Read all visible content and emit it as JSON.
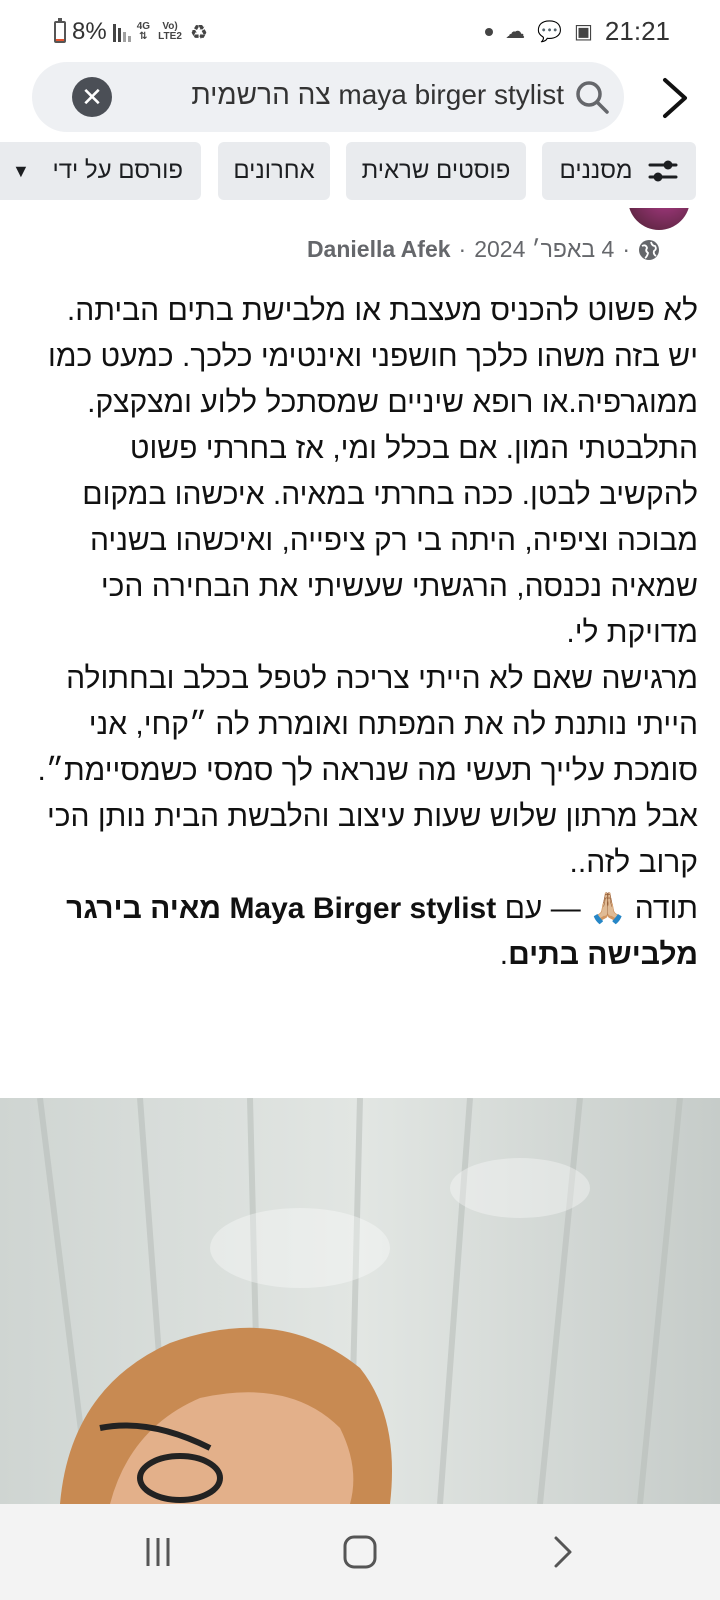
{
  "status_bar": {
    "battery": "8%",
    "network_top": "4G",
    "network_bottom": "Vo) LTE2",
    "time": "21:21",
    "battery_level": 0.08
  },
  "search": {
    "query": "maya birger stylist צה הרשמית",
    "clear_icon": "close-icon",
    "search_icon": "search-icon",
    "forward_icon": "chevron-right-icon"
  },
  "filters": {
    "filters_label": "מסננים",
    "photo_posts_label": "פוסטים שראית",
    "recent_label": "אחרונים",
    "posted_by_label": "פורסם על ידי"
  },
  "post": {
    "author": "Daniella Afek",
    "date": "4 באפר׳ 2024",
    "sep": "·",
    "privacy_icon": "globe-icon",
    "paragraphs": [
      "לא פשוט להכניס מעצבת או מלבישת בתים הביתה. יש בזה משהו כלכך חושפני ואינטימי כלכך. כמעט כמו ממוגרפיה.או רופא שיניים שמסתכל ללוע ומצקצק.",
      "התלבטתי המון. אם בכלל ומי, אז בחרתי פשוט להקשיב לבטן. ככה בחרתי במאיה. איכשהו במקום מבוכה וציפיה, היתה בי רק ציפייה, ואיכשהו בשניה שמאיה נכנסה, הרגשתי שעשיתי את הבחירה הכי מדויקת לי.",
      "מרגישה שאם לא הייתי צריכה לטפל בכלב ובחתולה הייתי נותנת לה את המפתח ואומרת לה ״קחי, אני סומכת עלייך תעשי מה שנראה לך סמסי כשמסיימת״.",
      "אבל מרתון שלוש שעות עיצוב והלבשת הבית נותן הכי קרוב לזה.."
    ],
    "thanks_prefix": "תודה 🙏🏼 — עם",
    "tagged_page": "Maya Birger stylist מאיה בירגר מלבישה בתים",
    "thanks_suffix": "."
  },
  "nav": {
    "recents_icon": "recent-apps-icon",
    "home_icon": "home-icon",
    "back_icon": "back-chevron-icon"
  }
}
